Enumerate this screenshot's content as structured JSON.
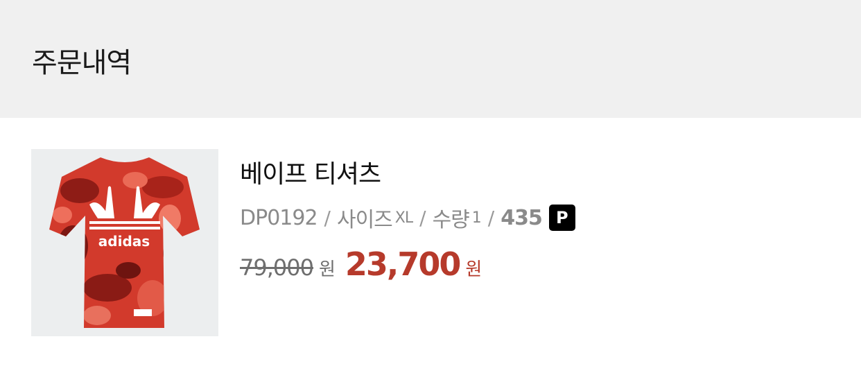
{
  "header": {
    "title": "주문내역"
  },
  "order": {
    "image_alt": "adidas",
    "product_name": "베이프 티셔츠",
    "code": "DP0192",
    "separator": "/",
    "size_label": "사이즈",
    "size_value": "XL",
    "qty_label": "수량",
    "qty_value": "1",
    "points": "435",
    "points_badge": "P",
    "original_price": "79,000",
    "original_unit": "원",
    "sale_price": "23,700",
    "sale_unit": "원"
  },
  "colors": {
    "header_bg": "#f0f0f0",
    "sale": "#b63a2b",
    "badge_bg": "#000000"
  }
}
